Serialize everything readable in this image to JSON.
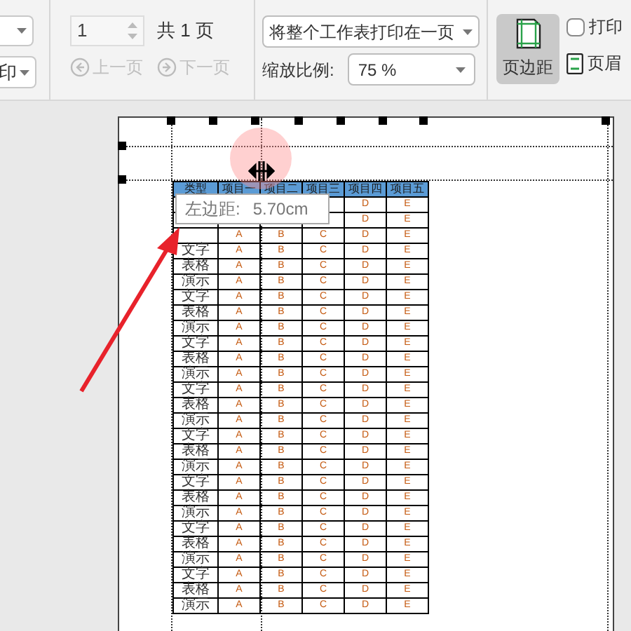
{
  "toolbar": {
    "left_dropdown_2": "印",
    "page_input": "1",
    "page_total": "共 1 页",
    "prev_page": {
      "label": "上一页",
      "disabled": true
    },
    "next_page": {
      "label": "下一页",
      "disabled": true
    },
    "fit_dropdown": "将整个工作表打印在一页",
    "scale_label": "缩放比例:",
    "scale_value": "75 %",
    "margin_button": {
      "label": "页边距",
      "selected": true
    },
    "print_checkbox": {
      "label": "打印",
      "checked": false
    },
    "header_button": "页眉"
  },
  "tooltip": {
    "label": "左边距:",
    "value": "5.70cm"
  },
  "table": {
    "columns": [
      "类型",
      "项目一",
      "项目二",
      "项目三",
      "项目四",
      "项目五"
    ],
    "rows": [
      {
        "cells": [
          null,
          null,
          null,
          null,
          "D",
          "E"
        ]
      },
      {
        "cells": [
          null,
          null,
          null,
          null,
          "D",
          "E"
        ]
      },
      {
        "cells": [
          null,
          "A",
          "B",
          "C",
          "D",
          "E"
        ]
      },
      {
        "cells": [
          "文字",
          "A",
          "B",
          "C",
          "D",
          "E"
        ]
      },
      {
        "cells": [
          "表格",
          "A",
          "B",
          "C",
          "D",
          "E"
        ]
      },
      {
        "cells": [
          "演示",
          "A",
          "B",
          "C",
          "D",
          "E"
        ]
      },
      {
        "cells": [
          "文字",
          "A",
          "B",
          "C",
          "D",
          "E"
        ]
      },
      {
        "cells": [
          "表格",
          "A",
          "B",
          "C",
          "D",
          "E"
        ]
      },
      {
        "cells": [
          "演示",
          "A",
          "B",
          "C",
          "D",
          "E"
        ]
      },
      {
        "cells": [
          "文字",
          "A",
          "B",
          "C",
          "D",
          "E"
        ]
      },
      {
        "cells": [
          "表格",
          "A",
          "B",
          "C",
          "D",
          "E"
        ]
      },
      {
        "cells": [
          "演示",
          "A",
          "B",
          "C",
          "D",
          "E"
        ]
      },
      {
        "cells": [
          "文字",
          "A",
          "B",
          "C",
          "D",
          "E"
        ]
      },
      {
        "cells": [
          "表格",
          "A",
          "B",
          "C",
          "D",
          "E"
        ]
      },
      {
        "cells": [
          "演示",
          "A",
          "B",
          "C",
          "D",
          "E"
        ]
      },
      {
        "cells": [
          "文字",
          "A",
          "B",
          "C",
          "D",
          "E"
        ]
      },
      {
        "cells": [
          "表格",
          "A",
          "B",
          "C",
          "D",
          "E"
        ]
      },
      {
        "cells": [
          "演示",
          "A",
          "B",
          "C",
          "D",
          "E"
        ]
      },
      {
        "cells": [
          "文字",
          "A",
          "B",
          "C",
          "D",
          "E"
        ]
      },
      {
        "cells": [
          "表格",
          "A",
          "B",
          "C",
          "D",
          "E"
        ]
      },
      {
        "cells": [
          "演示",
          "A",
          "B",
          "C",
          "D",
          "E"
        ]
      },
      {
        "cells": [
          "文字",
          "A",
          "B",
          "C",
          "D",
          "E"
        ]
      },
      {
        "cells": [
          "表格",
          "A",
          "B",
          "C",
          "D",
          "E"
        ]
      },
      {
        "cells": [
          "演示",
          "A",
          "B",
          "C",
          "D",
          "E"
        ]
      },
      {
        "cells": [
          "文字",
          "A",
          "B",
          "C",
          "D",
          "E"
        ]
      },
      {
        "cells": [
          "表格",
          "A",
          "B",
          "C",
          "D",
          "E"
        ]
      },
      {
        "cells": [
          "演示",
          "A",
          "B",
          "C",
          "D",
          "E"
        ]
      }
    ]
  }
}
